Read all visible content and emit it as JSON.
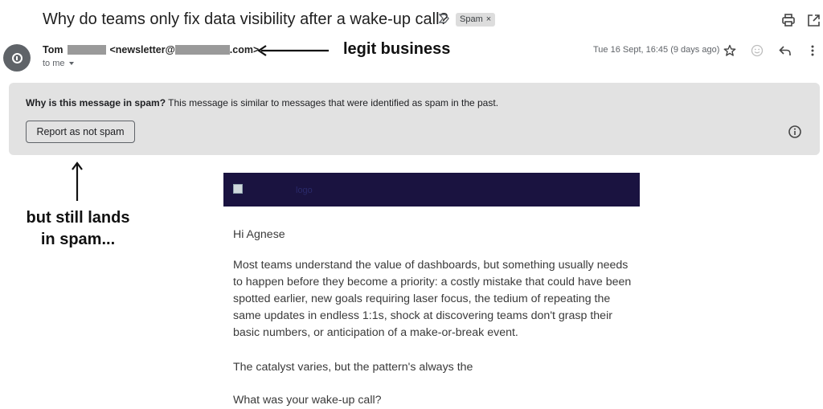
{
  "email": {
    "subject": "Why do teams only fix data visibility after a wake-up call?",
    "label_chip": "Spam",
    "label_remove": "×",
    "sender_name": "Tom",
    "sender_email_prefix": "<newsletter@",
    "sender_email_suffix": ".com>",
    "recipient": "to me",
    "date": "Tue 16 Sept, 16:45 (9 days ago)"
  },
  "spam_banner": {
    "heading": "Why is this message in spam?",
    "explanation": " This message is similar to messages that were identified as spam in the past.",
    "report_button": "Report as not spam"
  },
  "annotations": {
    "legit": "legit business",
    "still_spam_line1": "but still lands",
    "still_spam_line2": "in spam..."
  },
  "message": {
    "logo_alt": "logo",
    "greeting": "Hi Agnese",
    "paragraph_1": "Most teams understand the value of dashboards, but something usually needs to happen before they become a priority: a costly mistake that could have been spotted earlier, new goals requiring laser focus, the tedium of repeating the same updates in endless 1:1s, shock at discovering teams don't grasp their basic numbers, or anticipation of a make-or-break event.",
    "paragraph_2": "The catalyst varies, but the pattern's always the",
    "paragraph_3": "What was your wake-up call?"
  },
  "icons": [
    "importance-marker-icon",
    "print-icon",
    "open-in-new-window-icon",
    "avatar-alert-icon",
    "star-icon",
    "emoji-reaction-icon",
    "reply-icon",
    "more-vert-icon",
    "info-icon",
    "arrow-left-icon",
    "arrow-up-icon"
  ],
  "colors": {
    "banner_bg": "#e2e2e2",
    "header_bar": "#1a1340",
    "avatar": "#5f6368"
  }
}
